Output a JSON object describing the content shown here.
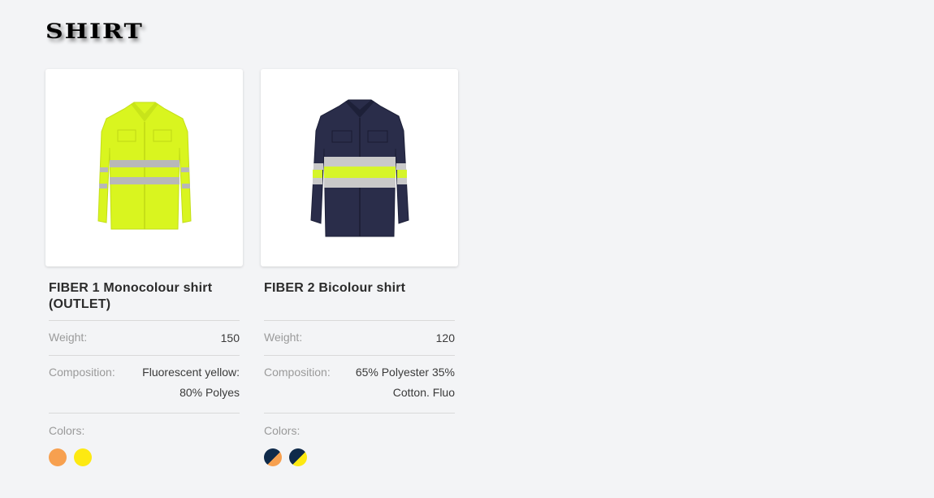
{
  "page": {
    "title": "SHIRT"
  },
  "products": [
    {
      "name": "FIBER 1 Monocolour shirt (OUTLET)",
      "weight_label": "Weight:",
      "weight": "150",
      "composition_label": "Composition:",
      "composition_line1": "Fluorescent yellow:",
      "composition_line2": "80% Polyes",
      "colors_label": "Colors:",
      "image_icon": "hi-vis-yellow-shirt-icon",
      "swatches": [
        {
          "name": "orange",
          "colors": [
            "#f7a04f"
          ]
        },
        {
          "name": "yellow",
          "colors": [
            "#fde912"
          ]
        }
      ]
    },
    {
      "name": "FIBER 2 Bicolour shirt",
      "weight_label": "Weight:",
      "weight": "120",
      "composition_label": "Composition:",
      "composition_line1": "65% Polyester 35%",
      "composition_line2": "Cotton. Fluo",
      "colors_label": "Colors:",
      "image_icon": "navy-bicolour-shirt-icon",
      "swatches": [
        {
          "name": "navy-orange",
          "colors": [
            "#0f2a4a",
            "#f7a04f"
          ]
        },
        {
          "name": "navy-yellow",
          "colors": [
            "#0f2a4a",
            "#fde912"
          ]
        }
      ]
    }
  ]
}
